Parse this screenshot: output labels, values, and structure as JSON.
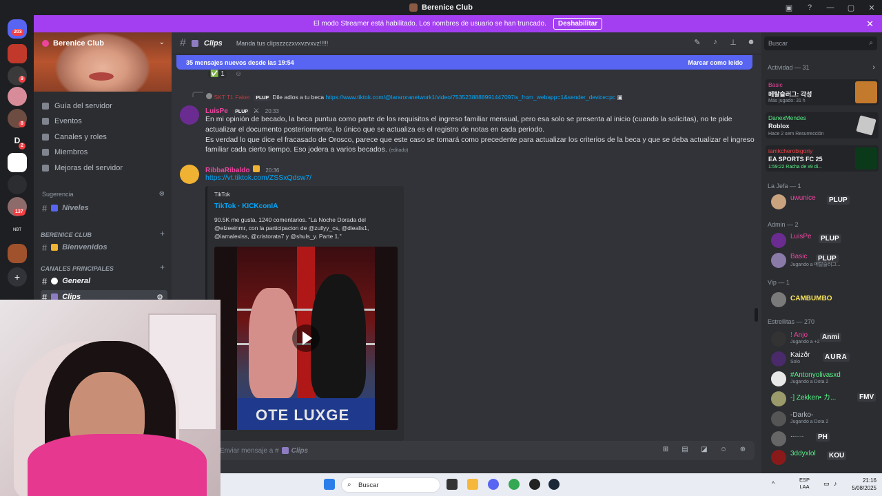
{
  "window": {
    "title": "Berenice Club",
    "controls": [
      "—",
      "▢",
      "✕"
    ]
  },
  "banner": {
    "text": "El modo Streamer está habilitado. Los nombres de usuario se han truncado.",
    "button": "Deshabilitar",
    "close": "✕"
  },
  "servers": {
    "badges": [
      "203",
      "9",
      "8",
      "2",
      "137"
    ],
    "labels": [
      "D",
      "NBT"
    ]
  },
  "server": {
    "name": "Berenice Club",
    "chevron": "⌄"
  },
  "sidebar_menu": [
    {
      "label": "Guía del servidor"
    },
    {
      "label": "Eventos"
    },
    {
      "label": "Canales y roles"
    },
    {
      "label": "Miembros"
    },
    {
      "label": "Mejoras del servidor"
    }
  ],
  "suggestion": {
    "title": "Sugerencia",
    "channel": "Niveles"
  },
  "categories": {
    "berenice": "BERENICE CLUB",
    "principales": "CANALES PRINCIPALES"
  },
  "channels": {
    "bienvenidos": "Bienvenidos",
    "general": "General",
    "clips": "Clips"
  },
  "header": {
    "channel": "Clips",
    "topic": "Manda tus clipszzczxvxvzvxvz!!!!!",
    "search_placeholder": "Buscar"
  },
  "new_messages": {
    "text": "35 mensajes nuevos desde las 19:54",
    "action": "Marcar como leído"
  },
  "reaction": {
    "emoji": "✅",
    "count": "1"
  },
  "reply": {
    "author": "SKT T1 Faker",
    "tag": "PLUP",
    "text": "Dile adios a tu beca",
    "link": "https://www.tiktok.com/@lararoranetwork1/video/7535238888991447097is_from_webapp=1&sender_device=pc"
  },
  "messages": [
    {
      "author": "LuisPe",
      "tag": "PLUP",
      "time": "20:33",
      "lines": [
        "En mi opinión de becado, la beca puntua como parte de los requisitos el ingreso familiar mensual, pero esa solo se presenta al inicio (cuando la solicitas), no te pide",
        "actualizar el documento posteriormente, lo único que se actualiza es el registro de notas en cada periodo.",
        "Es verdad lo que dice el fracasado de Orosco, parece que este caso se tomará como precedente para actualizar los criterios de la beca y que se deba actualizar el ingreso",
        "familiar cada cierto tiempo. Eso jodera a varios becados."
      ],
      "edited": "(editado)"
    },
    {
      "author": "RibbaRibaldo",
      "time": "20:36",
      "link": "https://vt.tiktok.com/ZSSxQdsw7/"
    }
  ],
  "embed": {
    "provider": "TikTok",
    "title": "TikTok · KICKconIA",
    "description": "90.5K me gusta, 1240 comentarios. \"La Noche Dorada del @elzeeinmr, con la participacion de @zullyy_cs, @diealis1, @iamalexiss, @cristorata7 y @shuls_y. Parte 1.\"",
    "image_text": "OTE LUXGE"
  },
  "composer": {
    "placeholder": "Enviar mensaje a #",
    "channel": "Clips"
  },
  "activity": {
    "title": "Actividad — 31",
    "cards": [
      {
        "name": "Basic",
        "game": "메탈슬러그: 각성",
        "detail": "Más jugado: 31 h"
      },
      {
        "name": "DanexMendes",
        "game": "Roblox",
        "detail": "Hace 2 sem   Resurrección"
      },
      {
        "name": "iamkcherobigoriy",
        "game": "EA SPORTS FC 25",
        "detail": "1:59:22   Racha de x9 di..."
      }
    ]
  },
  "member_groups": [
    {
      "title": "La Jefa — 1",
      "members": [
        {
          "name": "uwunice",
          "tag": "PLUP",
          "color": "#eb459e"
        }
      ]
    },
    {
      "title": "Admin — 2",
      "members": [
        {
          "name": "LuisPe",
          "tag": "PLUP",
          "color": "#eb459e"
        },
        {
          "name": "Basic",
          "tag": "PLUP",
          "status": "Jugando a 메탈슬러그...",
          "color": "#eb459e"
        }
      ]
    },
    {
      "title": "Vip — 1",
      "members": [
        {
          "name": "CAMBUMBO",
          "color": "#fee75c"
        }
      ]
    },
    {
      "title": "Estrellitas — 270",
      "members": [
        {
          "name": "! Anjo",
          "tag": "Anmi",
          "status": "Jugando a  +2",
          "color": "#eb459e"
        },
        {
          "name": "Kaizðr",
          "tag": "AURA",
          "status": "Solo",
          "color": "#f2f3f5"
        },
        {
          "name": "#Antonyolivasxd",
          "status": "Jugando a Dota 2",
          "color": "#57f287"
        },
        {
          "name": "-] Zekken• カ...",
          "tag": "FMV",
          "color": "#57f287"
        },
        {
          "name": "-Darko-",
          "status": "Jugando a Dota 2",
          "color": "#b5bac1"
        },
        {
          "name": ".......",
          "tag": "PH",
          "color": "#b5bac1"
        },
        {
          "name": "3ddyxlol",
          "tag": "KOU",
          "color": "#57f287"
        }
      ]
    }
  ],
  "taskbar": {
    "search": "Buscar",
    "lang1": "ESP",
    "lang2": "LAA",
    "time": "21:16",
    "date": "5/08/2025"
  }
}
